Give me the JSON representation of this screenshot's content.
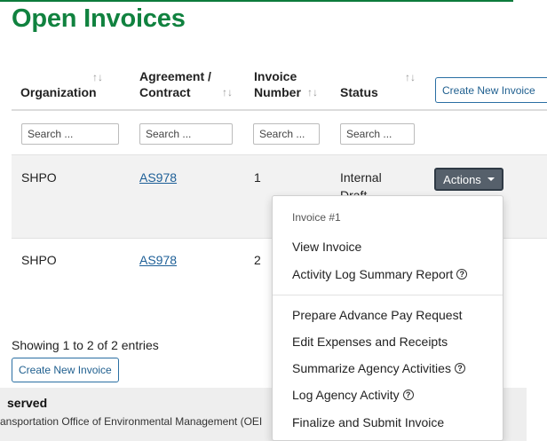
{
  "page": {
    "title": "Open Invoices",
    "brand_color": "#10823f"
  },
  "table": {
    "columns": [
      {
        "line1": "",
        "line2": "Organization",
        "sortable": true
      },
      {
        "line1": "Agreement /",
        "line2": "Contract",
        "sortable": true
      },
      {
        "line1": "Invoice",
        "line2": "Number",
        "sortable": true
      },
      {
        "line1": "",
        "line2": "Status",
        "sortable": true
      }
    ],
    "create_button": "Create New Invoice",
    "search_placeholder": "Search ...",
    "rows": [
      {
        "organization": "SHPO",
        "contract": "AS978",
        "invoice_number": "1",
        "status_line1": "Internal",
        "status_line2": "Draft"
      },
      {
        "organization": "SHPO",
        "contract": "AS978",
        "invoice_number": "2",
        "status_line1": "",
        "status_line2": ""
      }
    ],
    "actions_label": "Actions"
  },
  "dropdown": {
    "header": "Invoice #1",
    "items": [
      {
        "label": "View Invoice",
        "help": false
      },
      {
        "label": "Activity Log Summary Report",
        "help": true
      },
      {
        "label": "Prepare Advance Pay Request",
        "help": false
      },
      {
        "label": "Edit Expenses and Receipts",
        "help": false
      },
      {
        "label": "Summarize Agency Activities",
        "help": true
      },
      {
        "label": "Log Agency Activity",
        "help": true
      },
      {
        "label": "Finalize and Submit Invoice",
        "help": false
      }
    ],
    "help_icon_glyph": "?"
  },
  "summary": {
    "showing_text": "Showing 1 to 2 of 2 entries",
    "create_button": "Create New Invoice"
  },
  "footer": {
    "title": "served",
    "text": "ansportation Office of Environmental Management (OEI"
  }
}
